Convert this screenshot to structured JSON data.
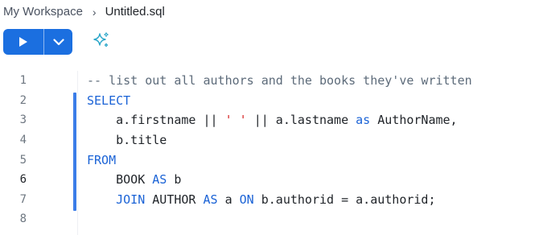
{
  "breadcrumb": {
    "root": "My Workspace",
    "separator": "›",
    "current": "Untitled.sql"
  },
  "toolbar": {
    "run_icon": "play-icon",
    "menu_icon": "chevron-down-icon",
    "ai_icon": "sparkles-icon"
  },
  "colors": {
    "accent": "#1b6fe0",
    "keyword": "#1b63d6",
    "string": "#d62828",
    "comment": "#5d6b7a",
    "gutter_bar": "#3b7de8"
  },
  "editor": {
    "active_line": 6,
    "lines": [
      {
        "number": "1",
        "tokens": [
          {
            "t": "-- list out all authors and the books they've written",
            "c": "comment"
          }
        ]
      },
      {
        "number": "2",
        "tokens": [
          {
            "t": "SELECT",
            "c": "kw"
          }
        ]
      },
      {
        "number": "3",
        "tokens": [
          {
            "t": "    a.firstname || ",
            "c": "plain"
          },
          {
            "t": "' '",
            "c": "str"
          },
          {
            "t": " || a.lastname ",
            "c": "plain"
          },
          {
            "t": "as",
            "c": "kw"
          },
          {
            "t": " AuthorName,",
            "c": "plain"
          }
        ]
      },
      {
        "number": "4",
        "tokens": [
          {
            "t": "    b.title",
            "c": "plain"
          }
        ]
      },
      {
        "number": "5",
        "tokens": [
          {
            "t": "FROM",
            "c": "kw"
          }
        ]
      },
      {
        "number": "6",
        "tokens": [
          {
            "t": "    BOOK ",
            "c": "plain"
          },
          {
            "t": "AS",
            "c": "kw"
          },
          {
            "t": " b",
            "c": "plain"
          }
        ]
      },
      {
        "number": "7",
        "tokens": [
          {
            "t": "    ",
            "c": "plain"
          },
          {
            "t": "JOIN",
            "c": "kw"
          },
          {
            "t": " AUTHOR ",
            "c": "plain"
          },
          {
            "t": "AS",
            "c": "kw"
          },
          {
            "t": " a ",
            "c": "plain"
          },
          {
            "t": "ON",
            "c": "kw"
          },
          {
            "t": " b.authorid = a.authorid;",
            "c": "plain"
          }
        ]
      },
      {
        "number": "8",
        "tokens": []
      }
    ]
  }
}
